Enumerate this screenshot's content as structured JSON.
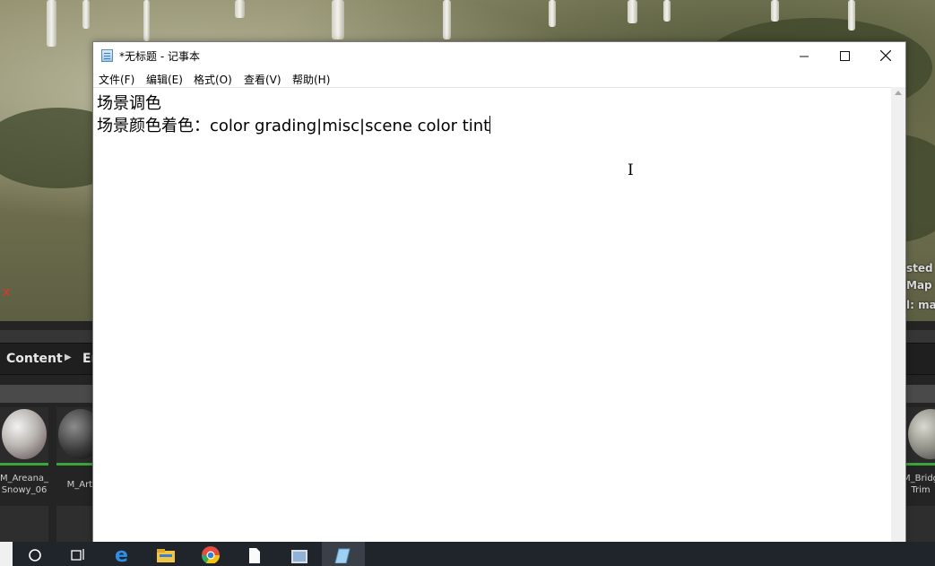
{
  "notepad": {
    "title": "*无标题 - 记事本",
    "menu": [
      "文件(F)",
      "编辑(E)",
      "格式(O)",
      "查看(V)",
      "帮助(H)"
    ],
    "lines": [
      "场景调色",
      "场景颜色着色：color grading|misc|scene color tint"
    ]
  },
  "background": {
    "scene_marker": "x",
    "scene_info": [
      "sted A",
      "Map (",
      "l: mai"
    ],
    "breadcrumb": [
      "Content",
      "En"
    ],
    "assets": [
      "M_Areana_\nSnowy_06",
      "M_Artif",
      "M_Bridg\nTrim"
    ]
  },
  "taskbar": {
    "icons": [
      "search-icon",
      "task-view-icon",
      "edge-icon",
      "file-explorer-icon",
      "chrome-icon",
      "document-icon",
      "image-viewer-icon",
      "notepad-icon"
    ]
  }
}
